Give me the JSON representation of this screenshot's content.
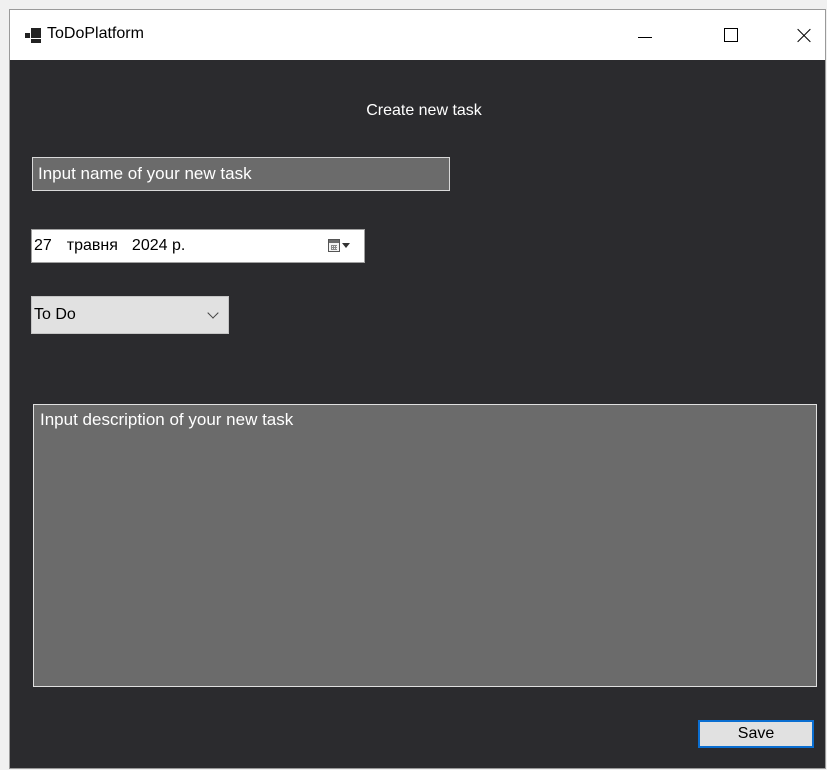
{
  "window": {
    "title": "ToDoPlatform",
    "icon": "app-window-icon",
    "controls": [
      "minimize-icon",
      "maximize-icon",
      "close-icon"
    ]
  },
  "form": {
    "heading": "Create new task",
    "name_placeholder": "Input name of your new task",
    "date": {
      "day": "27",
      "month": "травня",
      "year": "2024 р."
    },
    "status": "To Do",
    "description_placeholder": "Input description of your new task",
    "save_label": "Save"
  },
  "colors": {
    "background": "#2b2b2e",
    "input_background": "#6b6b6b",
    "accent": "#0a6ed1"
  }
}
